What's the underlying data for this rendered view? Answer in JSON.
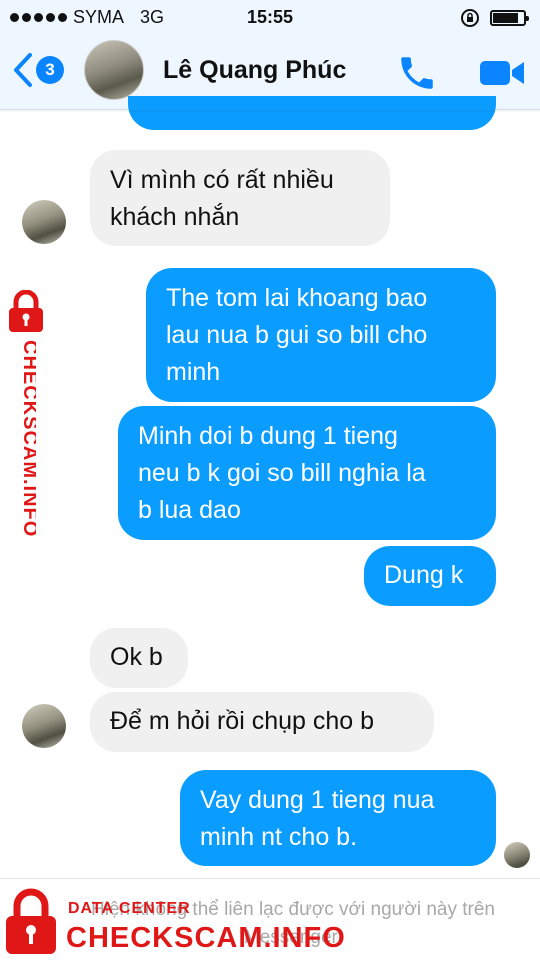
{
  "status_bar": {
    "carrier": "SYMA",
    "network": "3G",
    "time": "15:55"
  },
  "header": {
    "unread_count": "3",
    "contact_name": "Lê Quang Phúc"
  },
  "messages": [
    {
      "direction": "incoming",
      "text": "Vì mình có rất nhiều\nkhách nhắn"
    },
    {
      "direction": "outgoing",
      "text": "The tom lai khoang bao\nlau nua b gui so bill cho\nminh"
    },
    {
      "direction": "outgoing",
      "text": "Minh doi b dung 1 tieng\nneu b k goi so bill nghia la\nb lua dao"
    },
    {
      "direction": "outgoing",
      "text": "Dung k"
    },
    {
      "direction": "incoming",
      "text": "Ok b"
    },
    {
      "direction": "incoming",
      "text": "Để m hỏi rồi chụp cho b"
    },
    {
      "direction": "outgoing",
      "text": "Vay dung 1 tieng nua\nminh nt cho b."
    }
  ],
  "footer": {
    "notice": "Hiện không thể liên lạc được với người này trên Messenger."
  },
  "watermark": {
    "label_small": "DATA CENTER",
    "brand": "CHECKSCAM.INFO",
    "color": "#e01717"
  },
  "colors": {
    "outgoing_bubble": "#0a9dff",
    "incoming_bubble": "#f0f0f0",
    "accent": "#0a84ff",
    "header_bg": "#eef7ff"
  },
  "icons": {
    "back": "chevron-left-icon",
    "call": "phone-icon",
    "video": "video-camera-icon",
    "lock": "padlock-icon"
  }
}
